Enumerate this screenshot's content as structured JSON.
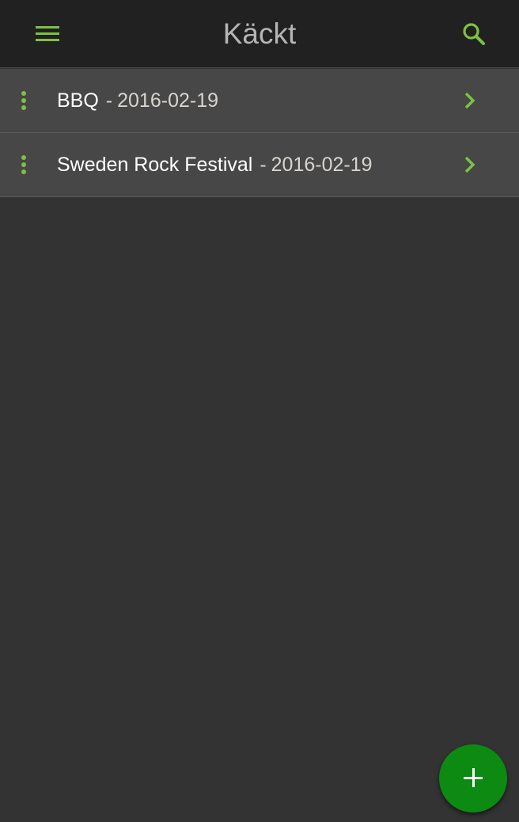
{
  "header": {
    "title": "Käckt",
    "menu_icon": "hamburger-menu-icon",
    "search_icon": "search-icon"
  },
  "events": [
    {
      "name": "BBQ",
      "separator": "-",
      "date": "2016-02-19"
    },
    {
      "name": "Sweden Rock Festival",
      "separator": "-",
      "date": "2016-02-19"
    }
  ],
  "fab": {
    "icon": "plus-icon"
  },
  "colors": {
    "accent": "#7cc242",
    "header_bg": "#212121",
    "background": "#333333",
    "row_bg": "#474747",
    "fab_bg": "#0c8a12"
  }
}
